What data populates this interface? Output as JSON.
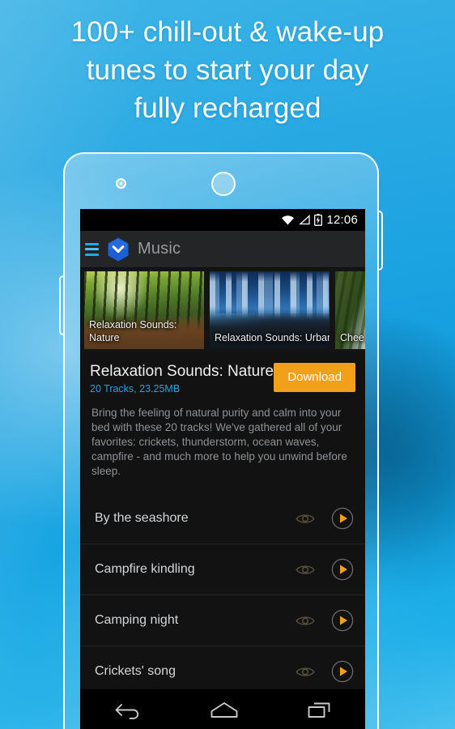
{
  "promo": {
    "headline": "100+ chill-out & wake-up tunes to start your day fully recharged",
    "headline_lines": [
      "100+ chill-out & wake-up",
      "tunes to start your day",
      "fully recharged"
    ],
    "background_color": "#17a0e0",
    "text_color": "#ffffff"
  },
  "device": {
    "frame_color": "#ffffff",
    "camera_icon": "camera-dot-icon",
    "speaker_icon": "speaker-sensor-icon"
  },
  "statusbar": {
    "time": "12:06",
    "icons": [
      "wifi-icon",
      "signal-icon",
      "battery-charging-icon"
    ]
  },
  "appbar": {
    "menu_icon": "hamburger-menu-icon",
    "logo_icon": "hexagon-chevron-logo-icon",
    "title": "Music",
    "logo_color": "#1c5fd4",
    "menu_color": "#26a8e8"
  },
  "cards": [
    {
      "label": "Relaxation Sounds: Nature",
      "art": "forest",
      "selected": true
    },
    {
      "label": "Relaxation Sounds: Urban",
      "art": "urban",
      "selected": false
    },
    {
      "label": "Cheerful Nature",
      "art": "falls",
      "selected": false
    }
  ],
  "album": {
    "title": "Relaxation Sounds: Nature",
    "meta": "20 Tracks, 23.25MB",
    "meta_color": "#2e9fdd",
    "download_label": "Download",
    "download_color": "#f2a01a",
    "description": "Bring the feeling of natural purity and calm into your bed with these 20 tracks! We've gathered all of your favorites: crickets, thunderstorm, ocean waves, campfire - and much more to help you unwind before sleep."
  },
  "tracks": [
    {
      "name": "By the seashore",
      "preview_icon": "eye-icon",
      "play_icon": "play-icon"
    },
    {
      "name": "Campfire kindling",
      "preview_icon": "eye-icon",
      "play_icon": "play-icon"
    },
    {
      "name": "Camping night",
      "preview_icon": "eye-icon",
      "play_icon": "play-icon"
    },
    {
      "name": "Crickets' song",
      "preview_icon": "eye-icon",
      "play_icon": "play-icon"
    }
  ],
  "navbar": {
    "back_icon": "back-arrow-icon",
    "home_icon": "home-icon",
    "recents_icon": "recent-apps-icon"
  }
}
